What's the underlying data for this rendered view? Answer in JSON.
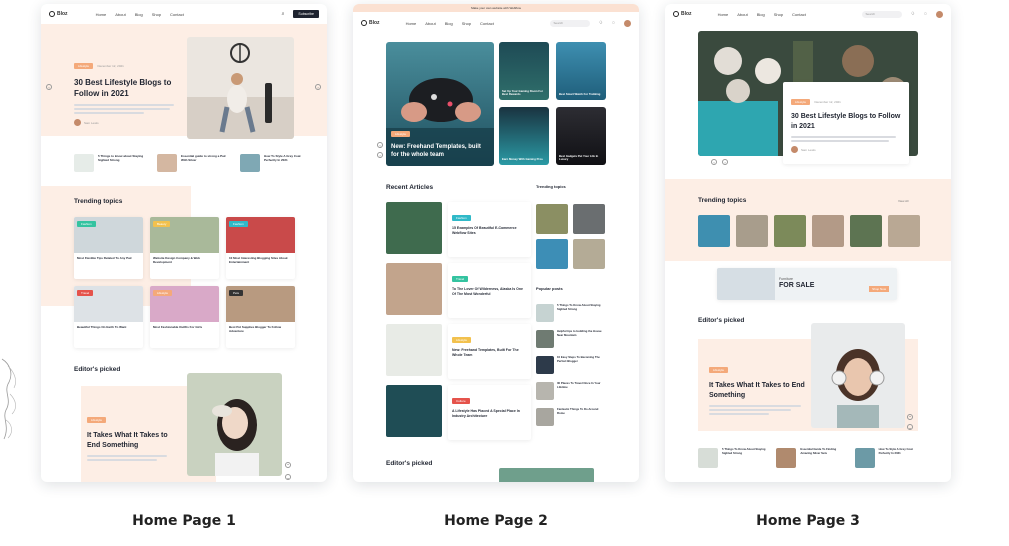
{
  "captions": [
    "Home Page 1",
    "Home Page 2",
    "Home Page 3"
  ],
  "nav": {
    "logo": "Bloz",
    "items": [
      "Home",
      "About",
      "Blog",
      "Shop",
      "Contact"
    ],
    "items2": [
      "Home",
      "About",
      "Blog",
      "Shop",
      "Contact"
    ],
    "subscribe": "Subscribe",
    "search_placeholder": "Search",
    "promo_text": "Make your own website with Webflow"
  },
  "page1": {
    "hero_tag": "Lifestyle",
    "hero_date": "December 12, 2021",
    "hero_title": "30 Best Lifestyle Blogs to Follow in 2021",
    "author": "Sam Lewis",
    "small_posts": [
      {
        "title": "5 Things to know about Staying Sighted Strong"
      },
      {
        "title": "Essential guide to strong a Pair With Silver"
      },
      {
        "title": "How To Style A Grey Coat Perfectly In 2021"
      }
    ],
    "trending": "Trending topics",
    "trend_posts": [
      {
        "tag": "Fashion",
        "title": "Most Flexible Tips Related To Any Pair"
      },
      {
        "tag": "Beauty",
        "title": "Website Design Company & Web Development"
      },
      {
        "tag": "Fashion",
        "title": "10 Most Interesting Blogging Sites About Entertainment"
      },
      {
        "tag": "Travel",
        "title": "Beautiful Things On Earth To Want"
      },
      {
        "tag": "Lifestyle",
        "title": "Most Fashionable Outfits For Girls"
      },
      {
        "tag": "Pets",
        "title": "Best Pet Supplies Blogger To Follow Adventure"
      }
    ],
    "editors": "Editor's picked",
    "editors_tag": "Lifestyle",
    "editors_title": "It Takes What It Takes to End Something"
  },
  "page2": {
    "hero_tag": "Lifestyle",
    "hero_title": "New: Freehand Templates, built for the whole team",
    "grid_posts": [
      {
        "title": "Set Up Your Gaming Room For Best Rewards"
      },
      {
        "title": "Best Smart Watch For Trekking"
      },
      {
        "title": "Earn Money With Gaming Pros"
      },
      {
        "title": "Best Gadgets Put Your Life In Luxury"
      }
    ],
    "recent": "Recent Articles",
    "recent_posts": [
      {
        "tag": "Fashion",
        "title": "15 Examples Of Beautiful E-Commerce Webflow Sites"
      },
      {
        "tag": "Travel",
        "title": "To The Lover Of Wilderness, Alaska Is One Of The Most Wonderful"
      },
      {
        "tag": "Lifestyle",
        "title": "New: Freehand Templates, Built For The Whole Team"
      },
      {
        "tag": "Culture",
        "title": "A Lifestyle Has Placed A Special Place In Industry Architecture"
      }
    ],
    "trending": "Trending topics",
    "popular": "Popular posts",
    "popular_posts": [
      {
        "title": "5 Things To Know About Staying Sighted Strong"
      },
      {
        "title": "Helpful tips to building the House Near Mountain"
      },
      {
        "title": "10 Easy Steps To Becoming The Perfect Blogger"
      },
      {
        "title": "30 Places To Travel Once In Your Lifetime"
      },
      {
        "title": "Fantastic Things To Do Around Rome"
      }
    ],
    "editors": "Editor's picked"
  },
  "page3": {
    "hero_tag": "Lifestyle",
    "hero_date": "December 12, 2021",
    "hero_title": "30 Best Lifestyle Blogs to Follow in 2021",
    "author": "Sam Lewis",
    "trending": "Trending topics",
    "view_all": "View All",
    "ad_small": "Furniture",
    "ad_big": "FOR SALE",
    "ad_btn": "Shop Now",
    "editors": "Editor's picked",
    "editors_tag": "Lifestyle",
    "editors_title": "It Takes What It Takes to End Something",
    "small_posts": [
      {
        "title": "5 Things To Know About Staying Sighted Strong"
      },
      {
        "title": "Essential Guide To Finding Amazing Silver Sets"
      },
      {
        "title": "How To Style A Grey Coat Perfectly In 2021"
      }
    ]
  }
}
